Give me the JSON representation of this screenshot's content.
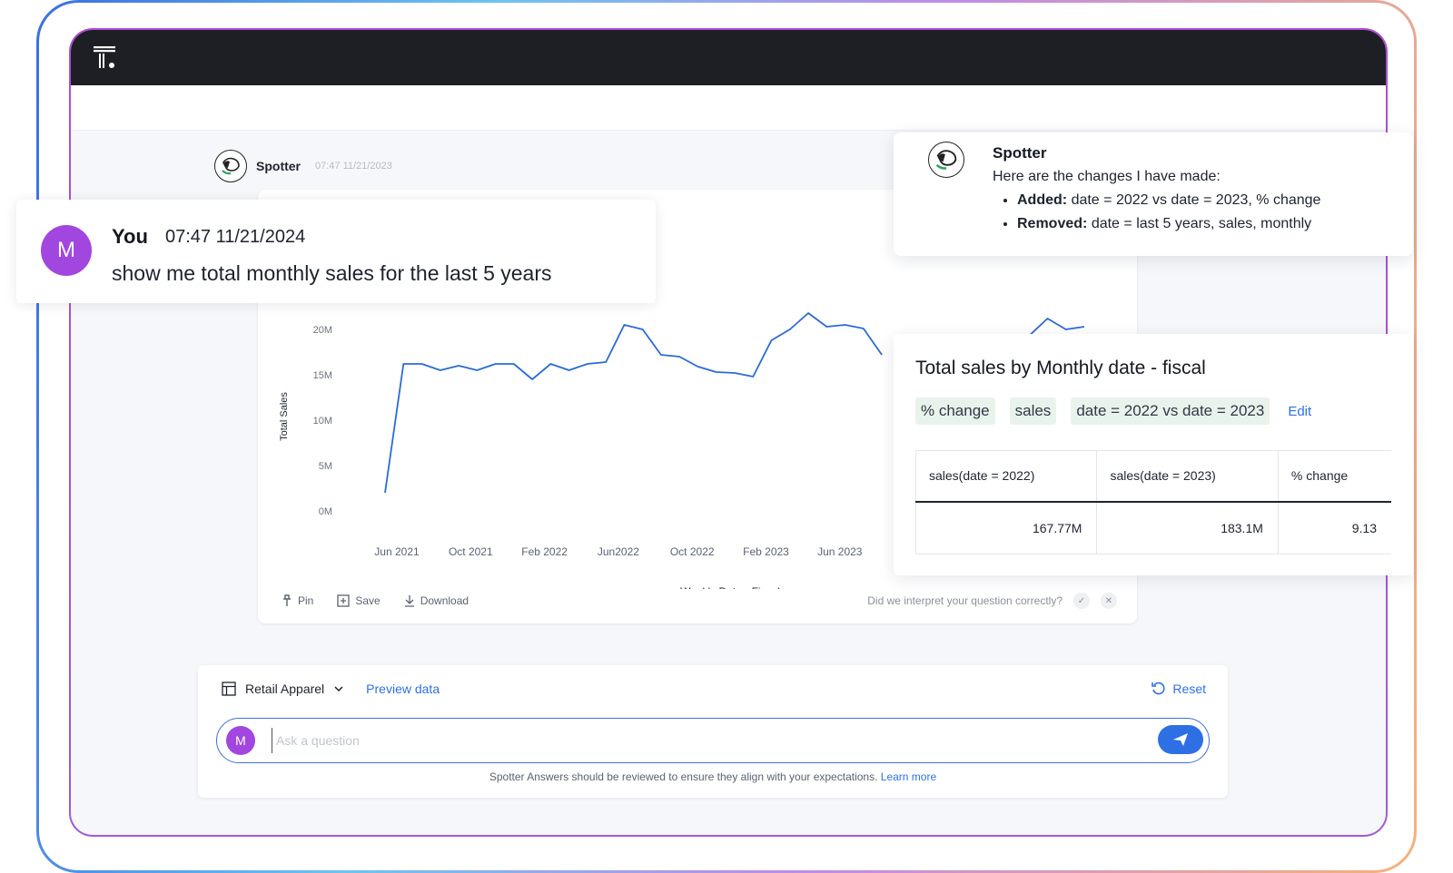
{
  "colors": {
    "accent": "#2f6fe4",
    "avatar": "#a246e0",
    "topbar": "#1d1f24",
    "line": "#2a6bd6",
    "chip_bg": "#e8f3ec"
  },
  "spotter": {
    "name": "Spotter",
    "timestamp": "07:47 11/21/2023"
  },
  "user_message": {
    "avatar_letter": "M",
    "name": "You",
    "timestamp": "07:47 11/21/2024",
    "text": "show me total monthly sales for the last 5 years"
  },
  "chart_data": {
    "type": "line",
    "ylabel": "Total Sales",
    "xlabel": "Weekly Date - Fiscal",
    "yticks": [
      "0M",
      "5M",
      "10M",
      "15M",
      "20M"
    ],
    "ylim": [
      0,
      20
    ],
    "xticks": [
      "Jun 2021",
      "Oct 2021",
      "Feb 2022",
      "Jun2022",
      "Oct 2022",
      "Feb 2023",
      "Jun 2023"
    ],
    "series": [
      {
        "values": [
          2.0,
          16.2,
          16.2,
          15.5,
          16.0,
          15.5,
          16.2,
          16.2,
          14.5,
          16.2,
          15.5,
          16.2,
          16.4,
          20.5,
          20.0,
          17.2,
          17.0,
          15.9,
          15.3,
          15.2,
          14.8,
          18.8,
          20.0,
          21.8,
          20.3,
          20.5,
          20.1,
          17.2,
          null,
          null,
          null,
          null,
          null,
          null,
          null,
          19.3,
          21.2,
          20.0,
          20.3
        ]
      }
    ],
    "grid": false,
    "legend": "none"
  },
  "chart_actions": {
    "pin": "Pin",
    "save": "Save",
    "download": "Download",
    "feedback_question": "Did we interpret your question correctly?"
  },
  "changes": {
    "name": "Spotter",
    "intro": "Here are the changes I have made:",
    "added_label": "Added:",
    "added_text": "date = 2022 vs date = 2023, % change",
    "removed_label": "Removed:",
    "removed_text": "date = last 5 years, sales, monthly"
  },
  "result": {
    "title": "Total sales by Monthly date - fiscal",
    "chips": [
      "% change",
      "sales",
      "date = 2022 vs date = 2023"
    ],
    "edit_label": "Edit",
    "columns": [
      "sales(date = 2022)",
      "sales(date = 2023)",
      "% change"
    ],
    "rows": [
      [
        "167.77M",
        "183.1M",
        "9.13"
      ]
    ]
  },
  "input_panel": {
    "datasource": "Retail Apparel",
    "preview_label": "Preview data",
    "reset_label": "Reset",
    "ask_avatar_letter": "M",
    "placeholder": "Ask a question",
    "disclaimer": "Spotter Answers should be reviewed to ensure they align with your expectations.",
    "learn_more": "Learn more"
  }
}
